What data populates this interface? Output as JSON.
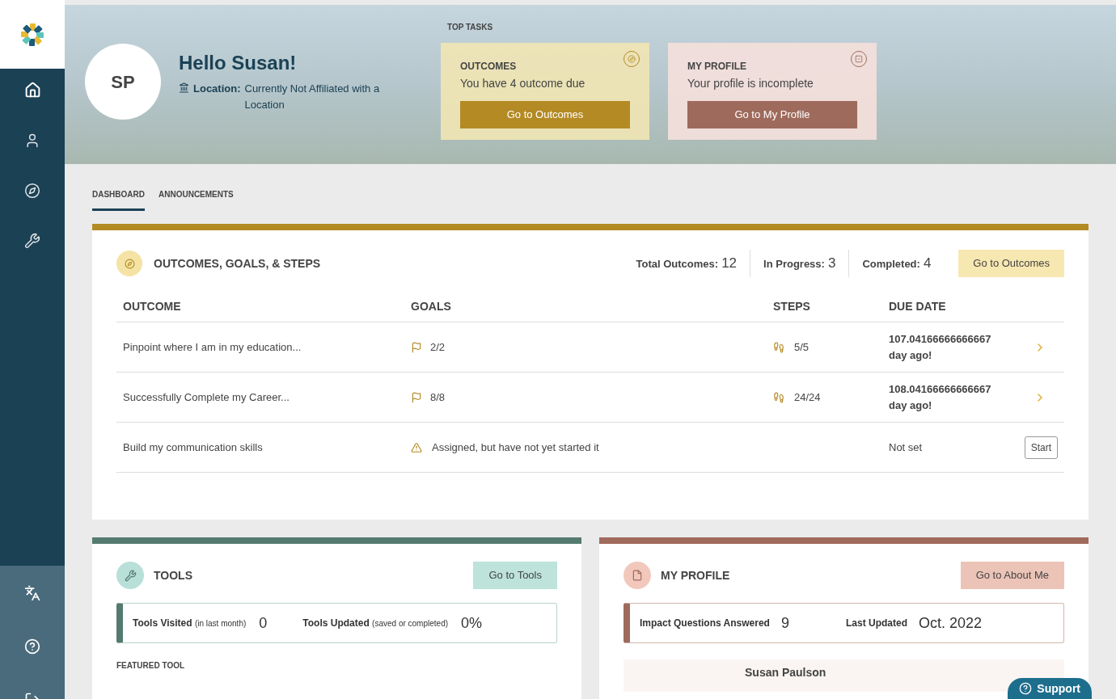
{
  "sidebar": {
    "items": [
      {
        "kind": "home",
        "selected": true
      },
      {
        "kind": "person",
        "selected": false
      },
      {
        "kind": "compass",
        "selected": false
      },
      {
        "kind": "wrench",
        "selected": false
      }
    ],
    "bottom_items": [
      {
        "kind": "translate"
      },
      {
        "kind": "help"
      },
      {
        "kind": "logout"
      }
    ]
  },
  "header": {
    "avatar_initials": "SP",
    "greeting": "Hello Susan!",
    "location_label": "Location:",
    "location_value": "Currently Not Affiliated with a Location",
    "top_tasks_title": "TOP TASKS",
    "tasks": [
      {
        "kind": "outcomes",
        "title": "OUTCOMES",
        "text": "You have 4 outcome due",
        "button": "Go to Outcomes"
      },
      {
        "kind": "profile",
        "title": "MY PROFILE",
        "text": "Your profile is incomplete",
        "button": "Go to My Profile"
      }
    ]
  },
  "tabs": [
    {
      "label": "DASHBOARD",
      "selected": true
    },
    {
      "label": "ANNOUNCEMENTS",
      "selected": false
    }
  ],
  "outcomes_card": {
    "title": "OUTCOMES, GOALS, & STEPS",
    "stats": [
      {
        "label": "Total Outcomes:",
        "value": "12"
      },
      {
        "label": "In Progress:",
        "value": "3"
      },
      {
        "label": "Completed:",
        "value": "4"
      }
    ],
    "button": "Go to Outcomes",
    "table": {
      "columns": [
        "OUTCOME",
        "GOALS",
        "STEPS",
        "DUE DATE"
      ],
      "rows": [
        {
          "kind": "progress",
          "outcome": "Pinpoint where I am in my education...",
          "goals": "2/2",
          "steps": "5/5",
          "due_date": "107.04166666666667 day ago!"
        },
        {
          "kind": "progress",
          "outcome": "Successfully Complete my Career...",
          "goals": "8/8",
          "steps": "24/24",
          "due_date": "108.04166666666667 day ago!"
        },
        {
          "kind": "not_started",
          "outcome": "Build my communication skills",
          "goals": "Assigned, but have not yet started it",
          "due_date": "Not set",
          "action": "Start"
        }
      ]
    }
  },
  "tools_card": {
    "title": "TOOLS",
    "button": "Go to Tools",
    "stats": [
      {
        "label": "Tools Visited",
        "note": "(in last month)",
        "value": "0"
      },
      {
        "label": "Tools Updated",
        "note": "(saved or completed)",
        "value": "0%"
      }
    ],
    "featured_title": "FEATURED TOOL"
  },
  "profile_card": {
    "title": "MY PROFILE",
    "button": "Go to About Me",
    "stats": [
      {
        "label": "Impact Questions Answered",
        "value": "9"
      },
      {
        "label": "Last Updated",
        "value": "Oct. 2022"
      }
    ],
    "person_name": "Susan Paulson"
  },
  "support_button": "Support"
}
